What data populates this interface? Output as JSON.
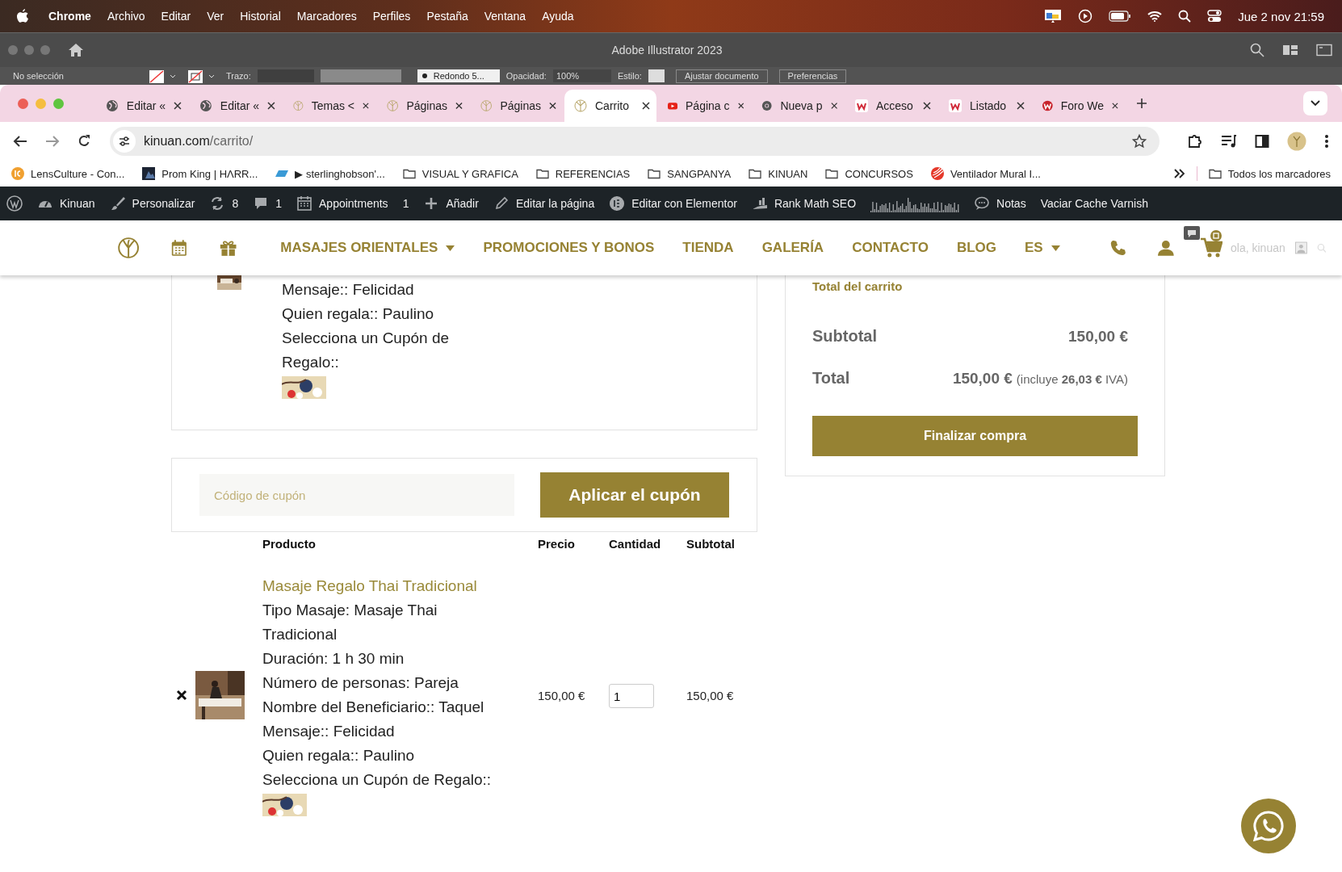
{
  "menubar": {
    "app": "Chrome",
    "menus": [
      "Archivo",
      "Editar",
      "Ver",
      "Historial",
      "Marcadores",
      "Perfiles",
      "Pestaña",
      "Ventana",
      "Ayuda"
    ],
    "clock": "Jue 2 nov 21:59"
  },
  "illustrator": {
    "title": "Adobe Illustrator 2023",
    "selection": "No selección",
    "stroke_label": "Trazo:",
    "brush": "Redondo 5...",
    "opacity_label": "Opacidad:",
    "opacity": "100%",
    "style_label": "Estilo:",
    "buttons": [
      "Ajustar documento",
      "Preferencias"
    ]
  },
  "browser": {
    "tabs": [
      {
        "title": "Editar «",
        "kind": "globe",
        "selected": false
      },
      {
        "title": "Editar «",
        "kind": "globe",
        "selected": false
      },
      {
        "title": "Temas <",
        "kind": "logo",
        "selected": false
      },
      {
        "title": "Páginas",
        "kind": "logo",
        "selected": false
      },
      {
        "title": "Páginas",
        "kind": "logo",
        "selected": false
      },
      {
        "title": "Carrito",
        "kind": "logo",
        "selected": true
      },
      {
        "title": "Página c",
        "kind": "video",
        "selected": false
      },
      {
        "title": "Nueva p",
        "kind": "browser",
        "selected": false
      },
      {
        "title": "Acceso",
        "kind": "brand",
        "selected": false
      },
      {
        "title": "Listado",
        "kind": "brand",
        "selected": false
      },
      {
        "title": "Foro We",
        "kind": "brand-round",
        "selected": false
      }
    ],
    "address": {
      "host": "kinuan.com",
      "path": "/carrito/"
    },
    "bookmarks": [
      {
        "label": "LensCulture - Con...",
        "kind": "lens"
      },
      {
        "label": "Prom King | HΛRR..."
      },
      {
        "label": "▶ sterlinghobson'...",
        "kind": "slant"
      },
      {
        "label": "VISUAL Y GRAFICA",
        "kind": "folder"
      },
      {
        "label": "REFERENCIAS",
        "kind": "folder"
      },
      {
        "label": "SANGPANYA",
        "kind": "folder"
      },
      {
        "label": "KINUAN",
        "kind": "folder"
      },
      {
        "label": "CONCURSOS",
        "kind": "folder"
      },
      {
        "label": "Ventilador Mural I...",
        "kind": "fan"
      }
    ],
    "all_bookmarks": "Todos los marcadores"
  },
  "admin_bar": {
    "items": [
      {
        "kind": "wordpress"
      },
      {
        "label": "Kinuan",
        "kind": "dashboard"
      },
      {
        "label": "Personalizar",
        "kind": "brush"
      },
      {
        "label": "8",
        "kind": "updates"
      },
      {
        "label": "1",
        "kind": "comments"
      },
      {
        "label": "Appointments",
        "kind": "calendar"
      },
      {
        "label": "1",
        "kind": "text"
      },
      {
        "label": "Añadir",
        "kind": "plus"
      },
      {
        "label": "Editar la página",
        "kind": "pencil"
      },
      {
        "label": "Editar con Elementor",
        "kind": "elementor"
      },
      {
        "label": "Rank Math SEO",
        "kind": "seo"
      },
      {
        "kind": "sparkline"
      },
      {
        "label": "Notas",
        "kind": "notes"
      },
      {
        "label": "Vaciar Cache Varnish",
        "kind": "text"
      }
    ]
  },
  "nav": {
    "items": [
      {
        "label": "MASAJES ORIENTALES",
        "dropdown": true
      },
      {
        "label": "PROMOCIONES Y BONOS",
        "dropdown": false
      },
      {
        "label": "TIENDA",
        "dropdown": false
      },
      {
        "label": "GALERÍA",
        "dropdown": false
      },
      {
        "label": "CONTACTO",
        "dropdown": false
      },
      {
        "label": "BLOG",
        "dropdown": false
      },
      {
        "label": "ES",
        "dropdown": true
      }
    ],
    "greeting": "ola, kinuan"
  },
  "cart": {
    "previous_item": {
      "details": [
        "Mensaje:: Felicidad",
        "Quien regala:: Paulino",
        "Selecciona un Cupón de Regalo::"
      ]
    },
    "coupon": {
      "placeholder": "Código de cupón",
      "button": "Aplicar el cupón"
    },
    "columns": [
      "Producto",
      "Precio",
      "Cantidad",
      "Subtotal"
    ],
    "items": [
      {
        "name": "Masaje Regalo Thai Tradicional",
        "details": [
          "Tipo Masaje: Masaje Thai Tradicional",
          "Duración: 1 h 30 min",
          "Número de personas: Pareja",
          "Nombre del Beneficiario:: Taquel",
          "Mensaje:: Felicidad",
          "Quien regala:: Paulino",
          "Selecciona un Cupón de Regalo::"
        ],
        "price": "150,00 €",
        "quantity": "1",
        "subtotal": "150,00 €"
      }
    ]
  },
  "totals": {
    "title": "Total del carrito",
    "rows": [
      {
        "label": "Subtotal",
        "value": "150,00 €"
      },
      {
        "label": "Total",
        "value": "150,00 €",
        "note": "(incluye **26,03 €** IVA)"
      }
    ],
    "checkout": "Finalizar compra"
  }
}
